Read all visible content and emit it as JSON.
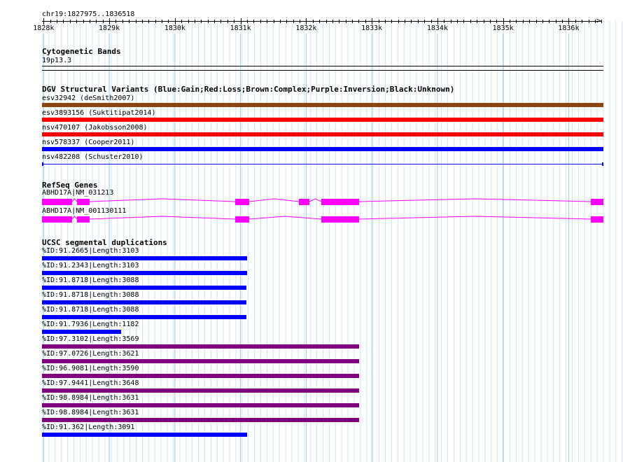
{
  "coords": "chr19:1827975..1836518",
  "ruler": {
    "start": 1827975,
    "end": 1836518,
    "ticks": [
      {
        "pos": 1828000,
        "label": "1828k"
      },
      {
        "pos": 1829000,
        "label": "1829k"
      },
      {
        "pos": 1830000,
        "label": "1830k"
      },
      {
        "pos": 1831000,
        "label": "1831k"
      },
      {
        "pos": 1832000,
        "label": "1832k"
      },
      {
        "pos": 1833000,
        "label": "1833k"
      },
      {
        "pos": 1834000,
        "label": "1834k"
      },
      {
        "pos": 1835000,
        "label": "1835k"
      },
      {
        "pos": 1836000,
        "label": "1836k"
      }
    ]
  },
  "cyto": {
    "title": "Cytogenetic Bands",
    "band": "19p13.3"
  },
  "dgv": {
    "title": "DGV Structural Variants (Blue:Gain;Red:Loss;Brown:Complex;Purple:Inversion;Black:Unknown)",
    "items": [
      {
        "label": "esv32942 (deSmith2007)",
        "color": "#8b4513",
        "type": "thick"
      },
      {
        "label": "esv3893156 (Suktitipat2014)",
        "color": "#ff0000",
        "type": "thick"
      },
      {
        "label": "nsv470107 (Jakobsson2008)",
        "color": "#ff0000",
        "type": "thick"
      },
      {
        "label": "nsv578337 (Cooper2011)",
        "color": "#0000ff",
        "type": "thick"
      },
      {
        "label": "nsv482208 (Schuster2010)",
        "color": "#0000ff",
        "type": "thin"
      }
    ]
  },
  "refseq": {
    "title": "RefSeq Genes",
    "color": "#ff00ff",
    "genes": [
      {
        "label": "ABHD17A|NM_031213"
      },
      {
        "label": "ABHD17A|NM_001130111"
      }
    ]
  },
  "segdup": {
    "title": "UCSC segmental duplications",
    "items": [
      {
        "label": "%ID:91.2665|Length:3103",
        "color": "#0000ff"
      },
      {
        "label": "%ID:91.2343|Length:3103",
        "color": "#0000ff"
      },
      {
        "label": "%ID:91.8718|Length:3088",
        "color": "#0000ff"
      },
      {
        "label": "%ID:91.8718|Length:3088",
        "color": "#0000ff"
      },
      {
        "label": "%ID:91.8718|Length:3088",
        "color": "#0000ff"
      },
      {
        "label": "%ID:91.7936|Length:1182",
        "color": "#0000ff"
      },
      {
        "label": "%ID:97.3102|Length:3569",
        "color": "#800080"
      },
      {
        "label": "%ID:97.0726|Length:3621",
        "color": "#800080"
      },
      {
        "label": "%ID:96.9081|Length:3590",
        "color": "#800080"
      },
      {
        "label": "%ID:97.9441|Length:3648",
        "color": "#800080"
      },
      {
        "label": "%ID:98.8984|Length:3631",
        "color": "#800080"
      },
      {
        "label": "%ID:98.8984|Length:3631",
        "color": "#800080"
      },
      {
        "label": "%ID:91.362|Length:3091",
        "color": "#0000ff"
      }
    ]
  }
}
